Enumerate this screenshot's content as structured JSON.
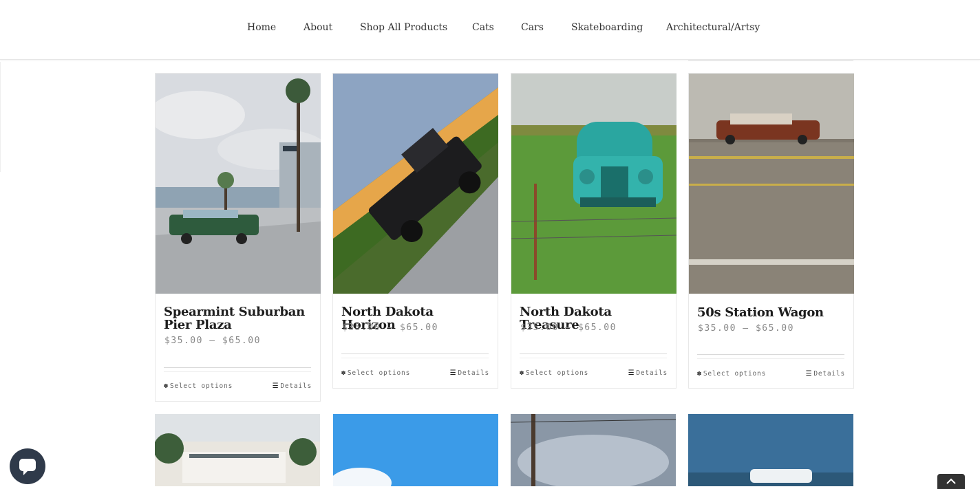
{
  "nav": {
    "items": [
      "Home",
      "About",
      "Shop All Products",
      "Cats",
      "Cars",
      "Skateboarding",
      "Architectural/Artsy"
    ]
  },
  "products": [
    {
      "title": "Spearmint Suburban Pier Plaza",
      "price": "$35.00 – $65.00",
      "select_label": "Select options",
      "details_label": "Details"
    },
    {
      "title": "North Dakota Horizon",
      "price": "$35.00 – $65.00",
      "select_label": "Select options",
      "details_label": "Details"
    },
    {
      "title": "North Dakota Treasure",
      "price": "$35.00 – $65.00",
      "select_label": "Select options",
      "details_label": "Details"
    },
    {
      "title": "50s Station Wagon",
      "price": "$35.00 – $65.00",
      "select_label": "Select options",
      "details_label": "Details"
    }
  ],
  "icons": {
    "options": "gear-icon",
    "details": "list-icon",
    "chat": "chat-bubble-icon",
    "scroll_top": "chevron-up-icon"
  }
}
